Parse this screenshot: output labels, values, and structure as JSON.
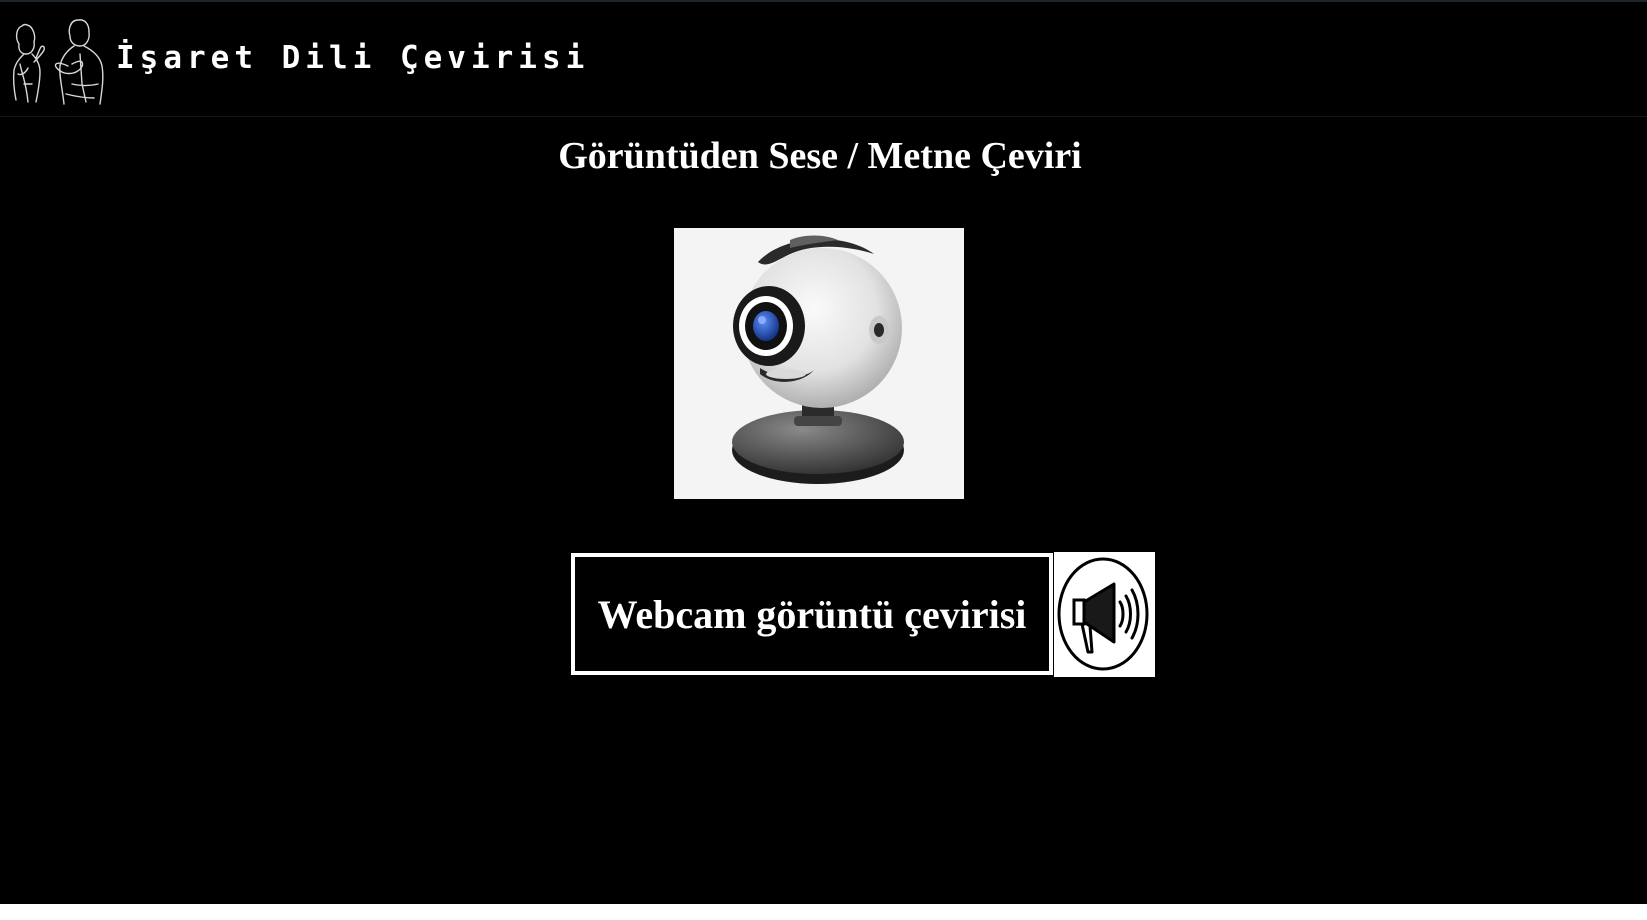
{
  "header": {
    "app_title": "İşaret Dili Çevirisi",
    "logo_icon": "sign-language-people-icon"
  },
  "main": {
    "page_title": "Görüntüden Sese / Metne Çeviri",
    "webcam_image_icon": "webcam-icon",
    "translate_button_label": "Webcam görüntü çevirisi",
    "speaker_icon": "megaphone-speaker-icon"
  },
  "colors": {
    "background": "#000000",
    "text": "#ffffff",
    "image_background": "#f4f4f4",
    "lens_blue": "#1e4fb0"
  }
}
